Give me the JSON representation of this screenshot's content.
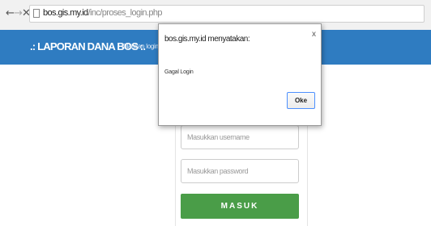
{
  "browser": {
    "back_icon": "arrow-left",
    "forward_icon": "arrow-right",
    "stop_icon": "close",
    "url_host": "bos.gis.my.id",
    "url_path": "/inc/proses_login.php"
  },
  "navbar": {
    "brand": ".: LAPORAN DANA BOS :.",
    "subtitle": "Silahkan login ter",
    "color": "#2f7cc1"
  },
  "form": {
    "username_placeholder": "Masukkan username",
    "password_placeholder": "Masukkan password",
    "submit_label": "MASUK",
    "submit_color": "#4a9d48"
  },
  "dialog": {
    "title": "bos.gis.my.id menyatakan:",
    "close_label": "x",
    "message": "Gagal Login",
    "ok_label": "Oke"
  }
}
